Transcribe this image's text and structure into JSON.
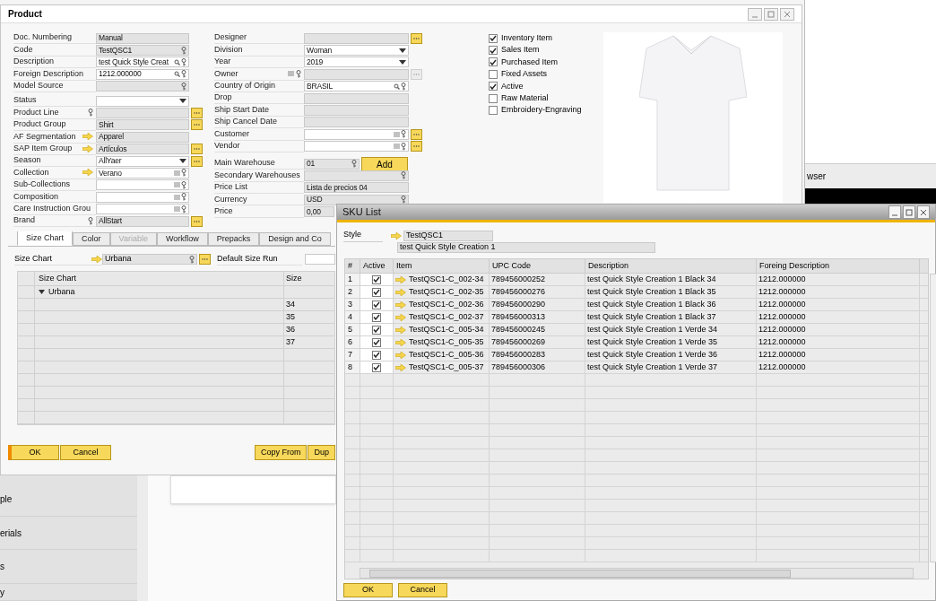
{
  "product_window": {
    "title": "Product"
  },
  "general_fields": [
    {
      "label": "Doc. Numbering",
      "value": "Manual",
      "kind": "plain",
      "editable": false
    },
    {
      "label": "Code",
      "value": "TestQSC1",
      "kind": "key",
      "editable": false
    },
    {
      "label": "Description",
      "value": "test Quick Style Creat",
      "kind": "search",
      "editable": true
    },
    {
      "label": "Foreign Description",
      "value": "1212.000000",
      "kind": "search",
      "editable": true
    },
    {
      "label": "Model Source",
      "kind": "key",
      "editable": false
    },
    {
      "label": "Status",
      "kind": "dropdown",
      "editable": true,
      "gap_before": true
    },
    {
      "label": "Product Line",
      "kind": "plain",
      "editable": false,
      "label_key": true,
      "browse": true
    },
    {
      "label": "Product Group",
      "value": "Shirt",
      "kind": "plain",
      "editable": false,
      "browse": true
    },
    {
      "label": "AF Segmentation",
      "value": "Apparel",
      "kind": "plain",
      "editable": false,
      "linked": true
    },
    {
      "label": "SAP Item Group",
      "value": "Artículos",
      "kind": "plain",
      "editable": false,
      "linked": true,
      "browse": true
    },
    {
      "label": "Season",
      "value": "AllYaer",
      "kind": "dropdown",
      "editable": true,
      "browse": true
    },
    {
      "label": "Collection",
      "value": "Verano",
      "kind": "list",
      "editable": true,
      "linked": true
    },
    {
      "label": "Sub-Collections",
      "kind": "list",
      "editable": true
    },
    {
      "label": "Composition",
      "kind": "list",
      "editable": true
    },
    {
      "label": "Care Instruction Grou",
      "kind": "list",
      "editable": true
    },
    {
      "label": "Brand",
      "value": "AllStart",
      "kind": "plain",
      "editable": false,
      "label_key": true,
      "browse": true
    }
  ],
  "detail_fields": [
    {
      "label": "Designer",
      "kind": "plain",
      "editable": false,
      "browse": true
    },
    {
      "label": "Division",
      "value": "Woman",
      "kind": "dropdown",
      "editable": true
    },
    {
      "label": "Year",
      "value": "2019",
      "kind": "dropdown",
      "editable": true
    },
    {
      "label": "Owner",
      "kind": "plain",
      "editable": false,
      "label_list": true,
      "browse": true,
      "browse_disabled": true
    },
    {
      "label": "Country of Origin",
      "value": "BRASIL",
      "kind": "search",
      "editable": true
    },
    {
      "label": "Drop",
      "kind": "plain",
      "editable": false
    },
    {
      "label": "Ship Start Date",
      "kind": "plain",
      "editable": false
    },
    {
      "label": "Ship Cancel Date",
      "kind": "plain",
      "editable": false
    },
    {
      "label": "Customer",
      "kind": "list",
      "editable": true,
      "browse": true
    },
    {
      "label": "Vendor",
      "kind": "list",
      "editable": true,
      "browse": true
    }
  ],
  "warehouse_fields": [
    {
      "label": "Main Warehouse",
      "value": "01",
      "kind": "key",
      "editable": false,
      "action": "Add"
    },
    {
      "label": "Secondary Warehouses",
      "kind": "key",
      "editable": false
    },
    {
      "label": "Price List",
      "value": "Lista de precios 04",
      "kind": "plain",
      "editable": false
    },
    {
      "label": "Currency",
      "value": "USD",
      "kind": "key",
      "editable": false
    },
    {
      "label": "Price",
      "value": "0,00",
      "kind": "plain",
      "editable": false
    }
  ],
  "flags": [
    {
      "label": "Inventory Item",
      "checked": true
    },
    {
      "label": "Sales Item",
      "checked": true
    },
    {
      "label": "Purchased Item",
      "checked": true
    },
    {
      "label": "Fixed Assets",
      "checked": false
    },
    {
      "label": "Active",
      "checked": true
    },
    {
      "label": "Raw Material",
      "checked": false
    },
    {
      "label": "Embroidery-Engraving",
      "checked": false
    }
  ],
  "tabs": [
    {
      "label": "Size Chart",
      "selected": true,
      "disabled": false
    },
    {
      "label": "Color",
      "selected": false,
      "disabled": false
    },
    {
      "label": "Variable",
      "selected": false,
      "disabled": true
    },
    {
      "label": "Workflow",
      "selected": false,
      "disabled": false
    },
    {
      "label": "Prepacks",
      "selected": false,
      "disabled": false
    },
    {
      "label": "Design and Co",
      "selected": false,
      "disabled": false
    }
  ],
  "size_chart_field": {
    "label": "Size Chart",
    "value": "Urbana"
  },
  "default_size_run": {
    "label": "Default Size Run"
  },
  "size_grid": {
    "columns": [
      "Size Chart",
      "Size"
    ],
    "groups": [
      {
        "name": "Urbana",
        "expanded": true,
        "sizes": [
          "34",
          "35",
          "36",
          "37"
        ]
      }
    ]
  },
  "product_buttons": [
    {
      "label": "OK",
      "focused": true
    },
    {
      "label": "Cancel",
      "focused": false
    }
  ],
  "tool_buttons": [
    "Copy From",
    "Dup"
  ],
  "background_app": {
    "sidebar_items": [
      "ple",
      "erials",
      "s",
      "y"
    ],
    "panel_title": "wser"
  },
  "sku_window": {
    "title": "SKU List",
    "style_label": "Style",
    "style_code": "TestQSC1",
    "style_description": "test Quick Style Creation 1",
    "columns": [
      "#",
      "Active",
      "Item",
      "UPC Code",
      "Description",
      "Foreing Description"
    ],
    "rows": [
      {
        "num": "1",
        "active": true,
        "item": "TestQSC1-C_002-34",
        "upc": "789456000252",
        "description": "test Quick Style Creation 1 Black 34",
        "foreign_description": "1212.000000"
      },
      {
        "num": "2",
        "active": true,
        "item": "TestQSC1-C_002-35",
        "upc": "789456000276",
        "description": "test Quick Style Creation 1 Black 35",
        "foreign_description": "1212.000000"
      },
      {
        "num": "3",
        "active": true,
        "item": "TestQSC1-C_002-36",
        "upc": "789456000290",
        "description": "test Quick Style Creation 1 Black 36",
        "foreign_description": "1212.000000"
      },
      {
        "num": "4",
        "active": true,
        "item": "TestQSC1-C_002-37",
        "upc": "789456000313",
        "description": "test Quick Style Creation 1 Black 37",
        "foreign_description": "1212.000000"
      },
      {
        "num": "5",
        "active": true,
        "item": "TestQSC1-C_005-34",
        "upc": "789456000245",
        "description": "test Quick Style Creation 1 Verde 34",
        "foreign_description": "1212.000000"
      },
      {
        "num": "6",
        "active": true,
        "item": "TestQSC1-C_005-35",
        "upc": "789456000269",
        "description": "test Quick Style Creation 1 Verde 35",
        "foreign_description": "1212.000000"
      },
      {
        "num": "7",
        "active": true,
        "item": "TestQSC1-C_005-36",
        "upc": "789456000283",
        "description": "test Quick Style Creation 1 Verde 36",
        "foreign_description": "1212.000000"
      },
      {
        "num": "8",
        "active": true,
        "item": "TestQSC1-C_005-37",
        "upc": "789456000306",
        "description": "test Quick Style Creation 1 Verde 37",
        "foreign_description": "1212.000000"
      }
    ],
    "buttons": [
      "OK",
      "Cancel"
    ]
  }
}
